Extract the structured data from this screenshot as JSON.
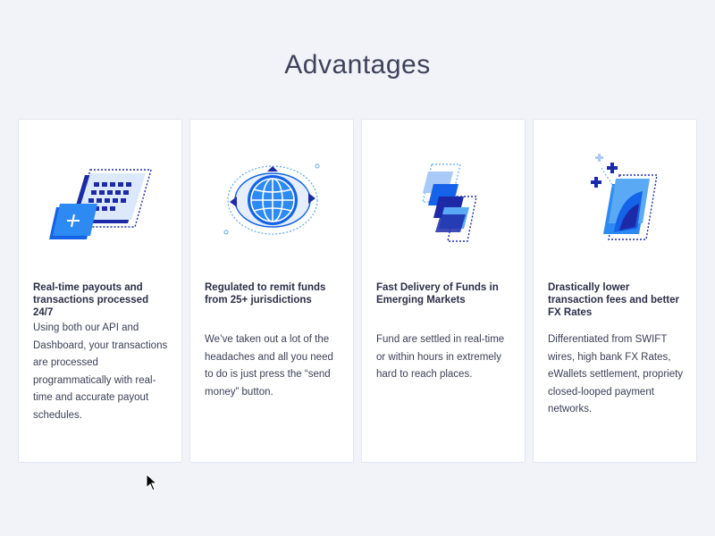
{
  "section": {
    "title": "Advantages"
  },
  "cards": [
    {
      "icon": "calendar-card-icon",
      "title": "Real-time payouts and transactions processed 24/7",
      "description": "Using both our API and Dashboard, your transactions are processed programmatically with real-time and accurate payout schedules."
    },
    {
      "icon": "globe-icon",
      "title": "Regulated to remit funds from 25+ jurisdictions",
      "description": "We’ve taken out a lot of the headaches and all you need to do is just press the “send money” button."
    },
    {
      "icon": "stacked-layers-icon",
      "title": "Fast Delivery of Funds in Emerging Markets",
      "description": "Fund are settled in real-time or within hours in extremely hard to reach places."
    },
    {
      "icon": "fx-card-icon",
      "title": "Drastically lower transaction fees and better FX Rates",
      "description": "Differentiated from SWIFT wires, high bank FX Rates, eWallets settlement, propriety closed-looped payment networks."
    }
  ],
  "colors": {
    "background": "#f1f3f9",
    "card": "#ffffff",
    "accent_blue": "#1463e8",
    "light_blue": "#5aa9f5",
    "navy": "#1c2aa8",
    "text_dark": "#2c2f48"
  }
}
